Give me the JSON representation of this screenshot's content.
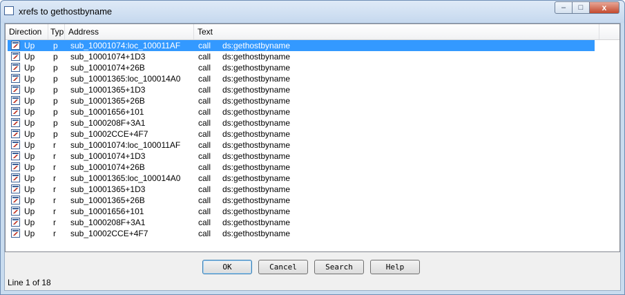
{
  "window": {
    "title": "xrefs to gethostbyname"
  },
  "caption_buttons": {
    "minimize": "–",
    "maximize": "□",
    "close": "x"
  },
  "table": {
    "headers": [
      "Direction",
      "Typ",
      "Address",
      "Text"
    ],
    "rows": [
      {
        "direction": "Up",
        "type": "p",
        "address": "sub_10001074:loc_100011AF",
        "text_instr": "call",
        "text_operand": "ds:gethostbyname"
      },
      {
        "direction": "Up",
        "type": "p",
        "address": "sub_10001074+1D3",
        "text_instr": "call",
        "text_operand": "ds:gethostbyname"
      },
      {
        "direction": "Up",
        "type": "p",
        "address": "sub_10001074+26B",
        "text_instr": "call",
        "text_operand": "ds:gethostbyname"
      },
      {
        "direction": "Up",
        "type": "p",
        "address": "sub_10001365:loc_100014A0",
        "text_instr": "call",
        "text_operand": "ds:gethostbyname"
      },
      {
        "direction": "Up",
        "type": "p",
        "address": "sub_10001365+1D3",
        "text_instr": "call",
        "text_operand": "ds:gethostbyname"
      },
      {
        "direction": "Up",
        "type": "p",
        "address": "sub_10001365+26B",
        "text_instr": "call",
        "text_operand": "ds:gethostbyname"
      },
      {
        "direction": "Up",
        "type": "p",
        "address": "sub_10001656+101",
        "text_instr": "call",
        "text_operand": "ds:gethostbyname"
      },
      {
        "direction": "Up",
        "type": "p",
        "address": "sub_1000208F+3A1",
        "text_instr": "call",
        "text_operand": "ds:gethostbyname"
      },
      {
        "direction": "Up",
        "type": "p",
        "address": "sub_10002CCE+4F7",
        "text_instr": "call",
        "text_operand": "ds:gethostbyname"
      },
      {
        "direction": "Up",
        "type": "r",
        "address": "sub_10001074:loc_100011AF",
        "text_instr": "call",
        "text_operand": "ds:gethostbyname"
      },
      {
        "direction": "Up",
        "type": "r",
        "address": "sub_10001074+1D3",
        "text_instr": "call",
        "text_operand": "ds:gethostbyname"
      },
      {
        "direction": "Up",
        "type": "r",
        "address": "sub_10001074+26B",
        "text_instr": "call",
        "text_operand": "ds:gethostbyname"
      },
      {
        "direction": "Up",
        "type": "r",
        "address": "sub_10001365:loc_100014A0",
        "text_instr": "call",
        "text_operand": "ds:gethostbyname"
      },
      {
        "direction": "Up",
        "type": "r",
        "address": "sub_10001365+1D3",
        "text_instr": "call",
        "text_operand": "ds:gethostbyname"
      },
      {
        "direction": "Up",
        "type": "r",
        "address": "sub_10001365+26B",
        "text_instr": "call",
        "text_operand": "ds:gethostbyname"
      },
      {
        "direction": "Up",
        "type": "r",
        "address": "sub_10001656+101",
        "text_instr": "call",
        "text_operand": "ds:gethostbyname"
      },
      {
        "direction": "Up",
        "type": "r",
        "address": "sub_1000208F+3A1",
        "text_instr": "call",
        "text_operand": "ds:gethostbyname"
      },
      {
        "direction": "Up",
        "type": "r",
        "address": "sub_10002CCE+4F7",
        "text_instr": "call",
        "text_operand": "ds:gethostbyname"
      }
    ],
    "selected_row": 0,
    "row_icon": "xref-icon"
  },
  "buttons": {
    "ok": "OK",
    "cancel": "Cancel",
    "search": "Search",
    "help": "Help"
  },
  "status": {
    "text": "Line 1 of 18"
  },
  "colors": {
    "selection": "#3399ff",
    "titlebar": "#c5d8ee",
    "close_button": "#c44a2e"
  }
}
